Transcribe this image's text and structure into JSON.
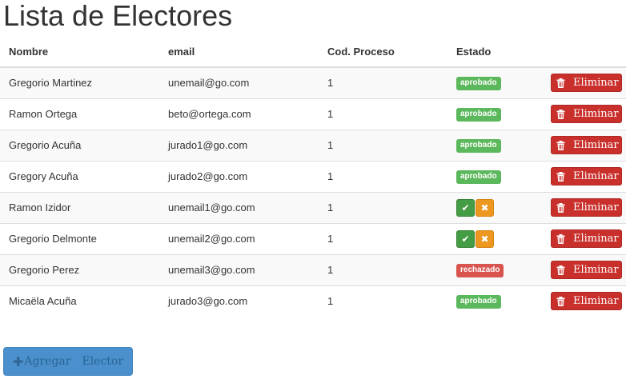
{
  "page": {
    "title": "Lista de Electores"
  },
  "table": {
    "headers": {
      "name": "Nombre",
      "email": "email",
      "process": "Cod. Proceso",
      "state": "Estado"
    },
    "rows": [
      {
        "name": "Gregorio Martinez",
        "email": "unemail@go.com",
        "process": "1",
        "state": "aprobado",
        "action": "Eliminar"
      },
      {
        "name": "Ramon Ortega",
        "email": "beto@ortega.com",
        "process": "1",
        "state": "aprobado",
        "action": "Eliminar"
      },
      {
        "name": "Gregorio Acuña",
        "email": "jurado1@go.com",
        "process": "1",
        "state": "aprobado",
        "action": "Eliminar"
      },
      {
        "name": "Gregory Acuña",
        "email": "jurado2@go.com",
        "process": "1",
        "state": "aprobado",
        "action": "Eliminar"
      },
      {
        "name": "Ramon Izidor",
        "email": "unemail1@go.com",
        "process": "1",
        "state": "pending",
        "action": "Eliminar"
      },
      {
        "name": "Gregorio Delmonte",
        "email": "unemail2@go.com",
        "process": "1",
        "state": "pending",
        "action": "Eliminar"
      },
      {
        "name": "Gregorio Perez",
        "email": "unemail3@go.com",
        "process": "1",
        "state": "rechazado",
        "action": "Eliminar"
      },
      {
        "name": "Micaëla Acuña",
        "email": "jurado3@go.com",
        "process": "1",
        "state": "aprobado",
        "action": "Eliminar"
      }
    ]
  },
  "footer": {
    "add_word1": "Agregar",
    "add_word2": "Elector"
  },
  "icons": {
    "approve": "check-icon",
    "reject": "times-icon",
    "delete": "trash-icon",
    "add": "plus-icon"
  },
  "colors": {
    "approved": "#5cb85c",
    "rejected": "#d9534f",
    "delete": "#c9302c",
    "warning": "#ec971f",
    "primary": "#428bca"
  }
}
